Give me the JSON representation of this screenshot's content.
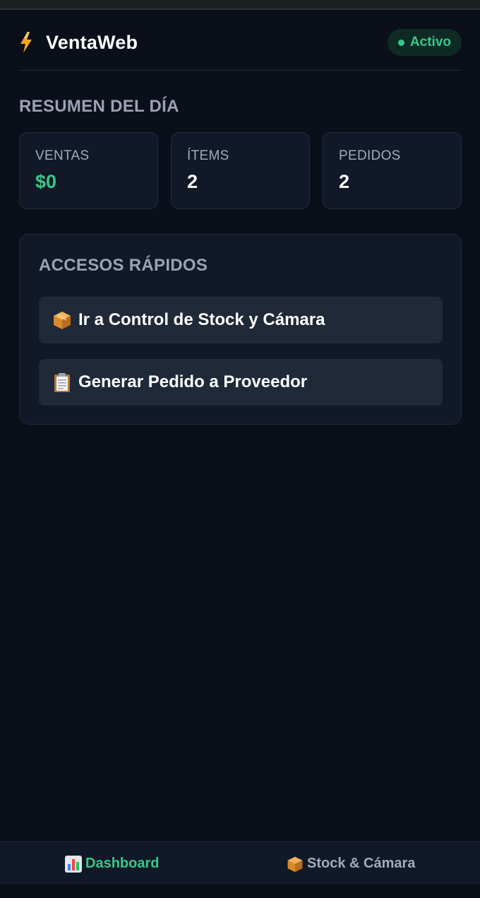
{
  "app": {
    "title": "VentaWeb",
    "status": "Activo",
    "accent_color": "#34c98a",
    "icon": "lightning-icon"
  },
  "summary": {
    "title": "RESUMEN DEL DÍA",
    "stats": [
      {
        "label": "VENTAS",
        "value": "$0"
      },
      {
        "label": "ÍTEMS",
        "value": "2"
      },
      {
        "label": "PEDIDOS",
        "value": "2"
      }
    ]
  },
  "quick_access": {
    "title": "ACCESOS RÁPIDOS",
    "buttons": [
      {
        "label": "Ir a Control de Stock y Cámara",
        "icon": "package-icon"
      },
      {
        "label": "Generar Pedido a Proveedor",
        "icon": "clipboard-icon"
      }
    ]
  },
  "bottom_nav": {
    "items": [
      {
        "label": "Dashboard",
        "icon": "bar-chart-icon",
        "active": true
      },
      {
        "label": "Stock & Cámara",
        "icon": "package-icon",
        "active": false
      }
    ]
  }
}
